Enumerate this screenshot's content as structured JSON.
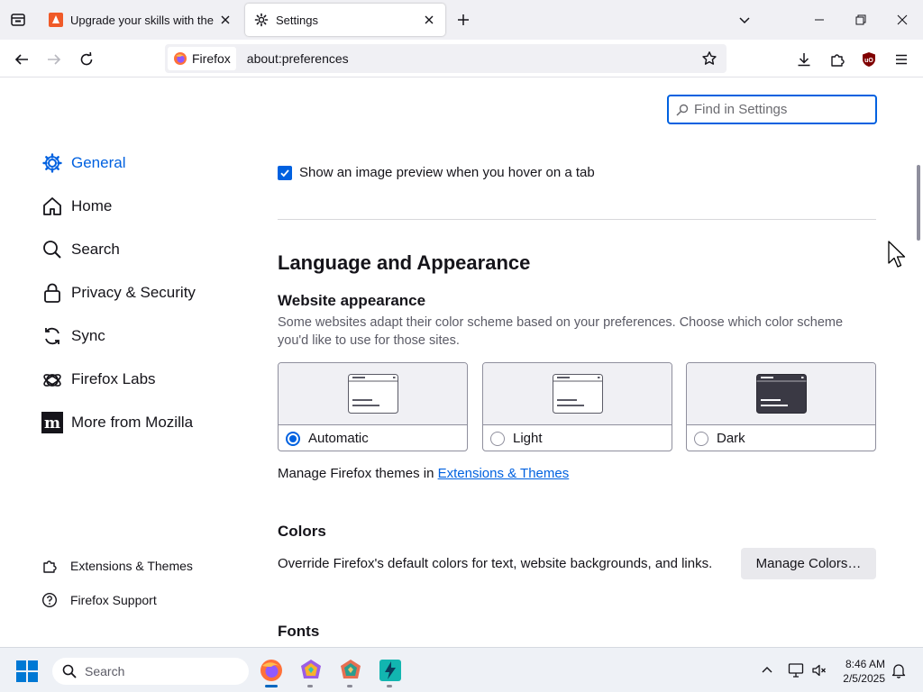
{
  "tabs": [
    {
      "title": "Upgrade your skills with the We",
      "favicon": "site-favicon-icon",
      "active": false
    },
    {
      "title": "Settings",
      "favicon": "gear-icon",
      "active": true
    }
  ],
  "urlbar": {
    "identity_label": "Firefox",
    "url": "about:preferences"
  },
  "search": {
    "placeholder": "Find in Settings"
  },
  "sidebar": {
    "categories": [
      {
        "label": "General",
        "icon": "gear-icon",
        "selected": true
      },
      {
        "label": "Home",
        "icon": "home-icon",
        "selected": false
      },
      {
        "label": "Search",
        "icon": "search-icon",
        "selected": false
      },
      {
        "label": "Privacy & Security",
        "icon": "lock-icon",
        "selected": false
      },
      {
        "label": "Sync",
        "icon": "sync-icon",
        "selected": false
      },
      {
        "label": "Firefox Labs",
        "icon": "flask-icon",
        "selected": false
      },
      {
        "label": "More from Mozilla",
        "icon": "mozilla-m-icon",
        "selected": false
      }
    ],
    "footer": [
      {
        "label": "Extensions & Themes",
        "icon": "puzzle-icon"
      },
      {
        "label": "Firefox Support",
        "icon": "help-icon"
      }
    ]
  },
  "main": {
    "tab_preview_checkbox": {
      "label": "Show an image preview when you hover on a tab",
      "checked": true
    },
    "section_title": "Language and Appearance",
    "website_appearance": {
      "heading": "Website appearance",
      "description": "Some websites adapt their color scheme based on your preferences. Choose which color scheme you'd like to use for those sites.",
      "options": [
        {
          "label": "Automatic",
          "checked": true
        },
        {
          "label": "Light",
          "checked": false
        },
        {
          "label": "Dark",
          "checked": false
        }
      ]
    },
    "themes_line": {
      "prefix": "Manage Firefox themes in ",
      "link": "Extensions & Themes"
    },
    "colors": {
      "heading": "Colors",
      "description": "Override Firefox's default colors for text, website backgrounds, and links.",
      "button": "Manage Colors…"
    },
    "fonts": {
      "heading": "Fonts"
    }
  },
  "taskbar": {
    "search_placeholder": "Search",
    "time": "8:46 AM",
    "date": "2/5/2025"
  },
  "colors": {
    "accent": "#0061e0",
    "tabstrip_bg": "#f0f0f4",
    "taskbar_bg": "#eef1f6"
  }
}
